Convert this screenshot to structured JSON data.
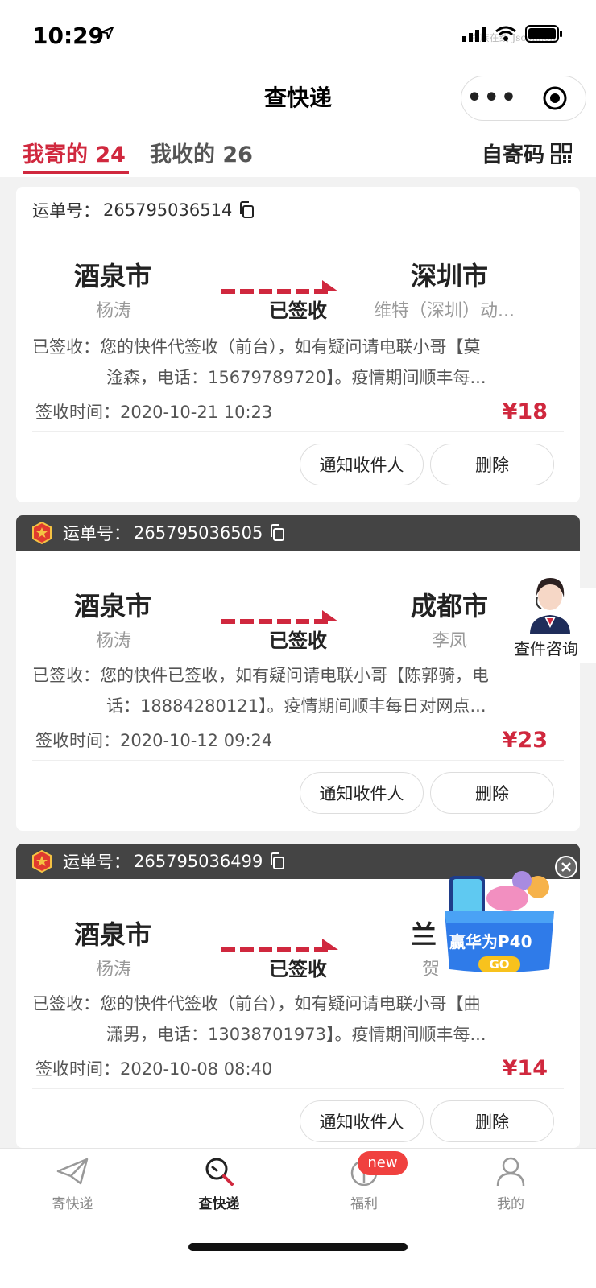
{
  "status_bar": {
    "time": "10:29",
    "watermark": "海族在线 Jscom.cn"
  },
  "header": {
    "title": "查快递",
    "more_label": "•••"
  },
  "tabs": [
    {
      "label": "我寄的 24",
      "active": true
    },
    {
      "label": "我收的 26",
      "active": false
    }
  ],
  "self_code": {
    "label": "自寄码"
  },
  "accent_color": "#d0283e",
  "cards": [
    {
      "waybill_label": "运单号：",
      "waybill": "265795036514",
      "vip": false,
      "from_city": "酒泉市",
      "from_person": "杨涛",
      "to_city": "深圳市",
      "to_person": "维特（深圳）动...",
      "status": "已签收",
      "detail_line1": "已签收：您的快件代签收（前台），如有疑问请电联小哥【莫",
      "detail_line2": "淦森，电话：15679789720】。疫情期间顺丰每...",
      "sign_time": "签收时间：2020-10-21 10:23",
      "price": "¥18",
      "notify": "通知收件人",
      "delete": "删除"
    },
    {
      "waybill_label": "运单号：",
      "waybill": "265795036505",
      "vip": true,
      "from_city": "酒泉市",
      "from_person": "杨涛",
      "to_city": "成都市",
      "to_person": "李凤",
      "status": "已签收",
      "detail_line1": "已签收：您的快件已签收，如有疑问请电联小哥【陈郭骑，电",
      "detail_line2": "话：18884280121】。疫情期间顺丰每日对网点...",
      "sign_time": "签收时间：2020-10-12 09:24",
      "price": "¥23",
      "notify": "通知收件人",
      "delete": "删除"
    },
    {
      "waybill_label": "运单号：",
      "waybill": "265795036499",
      "vip": true,
      "from_city": "酒泉市",
      "from_person": "杨涛",
      "to_city": "兰",
      "to_person": "贺",
      "status": "已签收",
      "detail_line1": "已签收：您的快件代签收（前台），如有疑问请电联小哥【曲",
      "detail_line2": "潇男，电话：13038701973】。疫情期间顺丰每...",
      "sign_time": "签收时间：2020-10-08 08:40",
      "price": "¥14",
      "notify": "通知收件人",
      "delete": "删除"
    }
  ],
  "consult": {
    "label": "查件咨询"
  },
  "promo": {
    "title": "赢华为P40",
    "go": "GO"
  },
  "bottom_nav": [
    {
      "label": "寄快递",
      "icon": "paper-plane-icon",
      "active": false
    },
    {
      "label": "查快递",
      "icon": "search-icon",
      "active": true
    },
    {
      "label": "福利",
      "icon": "gift-icon",
      "active": false,
      "badge": "new"
    },
    {
      "label": "我的",
      "icon": "person-icon",
      "active": false
    }
  ]
}
